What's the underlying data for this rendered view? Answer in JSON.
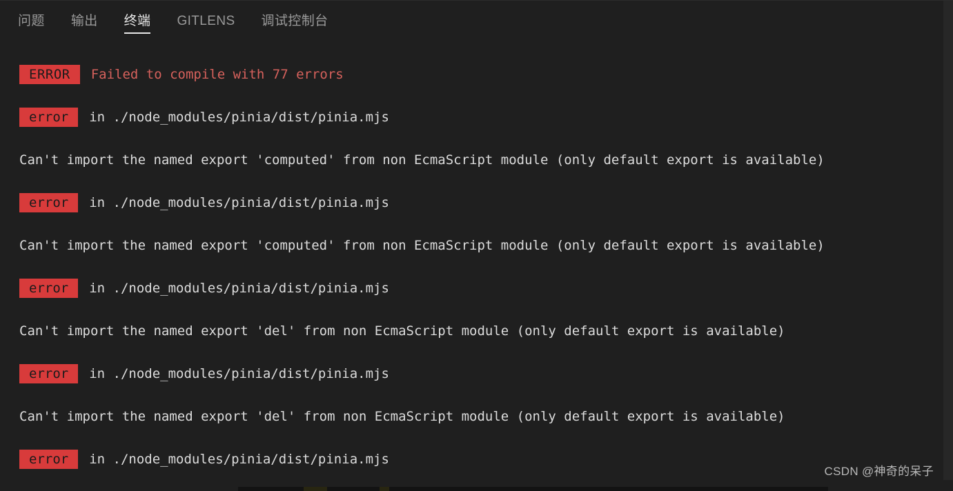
{
  "panel": {
    "tabs": [
      {
        "label": "问题",
        "active": false
      },
      {
        "label": "输出",
        "active": false
      },
      {
        "label": "终端",
        "active": true
      },
      {
        "label": "GITLENS",
        "active": false
      },
      {
        "label": "调试控制台",
        "active": false
      }
    ]
  },
  "colors": {
    "background": "#1f1f1f",
    "badge_background": "#d83b3b",
    "badge_text": "#1b1b1b",
    "error_message": "#d6615c",
    "terminal_text": "#dcdcdc",
    "tab_inactive": "#9a9a9a",
    "tab_active": "#e8e8e8",
    "gutter": "#272727"
  },
  "terminal": {
    "lines": [
      {
        "kind": "badge-line",
        "badge": "ERROR",
        "badge_case": "upper",
        "message": "Failed to compile with 77 errors",
        "message_style": "red"
      },
      {
        "kind": "badge-line",
        "badge": "error",
        "badge_case": "lower",
        "message": "in ./node_modules/pinia/dist/pinia.mjs",
        "message_style": "light"
      },
      {
        "kind": "detail",
        "text": "Can't import the named export 'computed' from non EcmaScript module (only default export is available)"
      },
      {
        "kind": "badge-line",
        "badge": "error",
        "badge_case": "lower",
        "message": "in ./node_modules/pinia/dist/pinia.mjs",
        "message_style": "light"
      },
      {
        "kind": "detail",
        "text": "Can't import the named export 'computed' from non EcmaScript module (only default export is available)"
      },
      {
        "kind": "badge-line",
        "badge": "error",
        "badge_case": "lower",
        "message": "in ./node_modules/pinia/dist/pinia.mjs",
        "message_style": "light"
      },
      {
        "kind": "detail",
        "text": "Can't import the named export 'del' from non EcmaScript module (only default export is available)"
      },
      {
        "kind": "badge-line",
        "badge": "error",
        "badge_case": "lower",
        "message": "in ./node_modules/pinia/dist/pinia.mjs",
        "message_style": "light"
      },
      {
        "kind": "detail",
        "text": "Can't import the named export 'del' from non EcmaScript module (only default export is available)"
      },
      {
        "kind": "badge-line",
        "badge": "error",
        "badge_case": "lower",
        "message": "in ./node_modules/pinia/dist/pinia.mjs",
        "message_style": "light"
      }
    ]
  },
  "watermark": {
    "text": "CSDN @神奇的呆子"
  }
}
